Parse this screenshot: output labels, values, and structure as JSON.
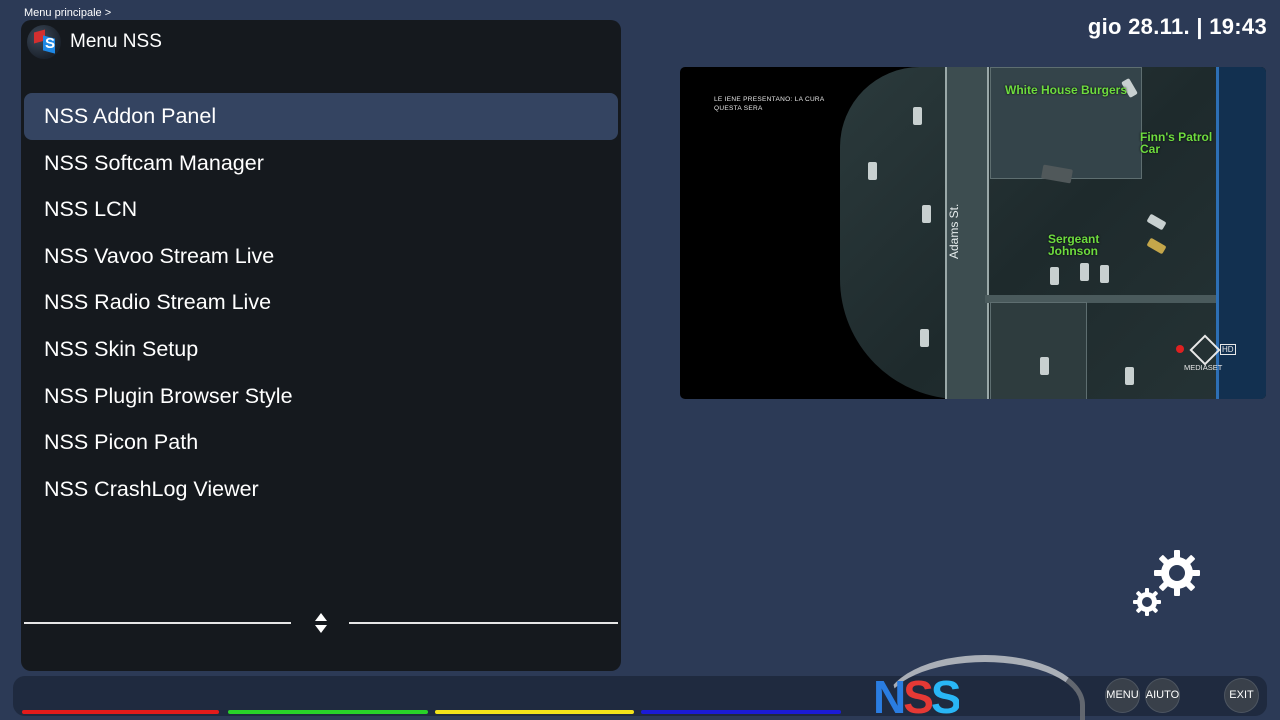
{
  "breadcrumb": "Menu principale >",
  "clock": {
    "date": "gio 28.11.",
    "separator": "|",
    "time": "19:43"
  },
  "menu": {
    "title": "Menu NSS",
    "selected_index": 0,
    "items": [
      "NSS Addon Panel",
      "NSS Softcam Manager",
      "NSS LCN",
      "NSS Vavoo Stream Live",
      "NSS Radio Stream Live",
      "NSS Skin Setup",
      "NSS Plugin Browser Style",
      "NSS Picon Path",
      "NSS CrashLog Viewer"
    ]
  },
  "preview": {
    "overlay_line1": "LE IENE PRESENTANO: LA CURA",
    "overlay_line2": "QUESTA SERA",
    "labels": {
      "white_house": "White House Burgers",
      "finns": "Finn's Patrol Car",
      "sergeant": "Sergeant Johnson",
      "street": "Adams St."
    },
    "channel": "MEDIASET"
  },
  "footer": {
    "logo_text": "NSS",
    "buttons": {
      "menu": "MENU",
      "help": "AIUTO",
      "exit": "EXIT"
    },
    "color_keys": {
      "red": "#e31b1b",
      "green": "#29d129",
      "yellow": "#f2e21b",
      "blue": "#1b1bd6"
    }
  },
  "icons": {
    "header_logo": "nss-cube-icon",
    "settings": "gears-icon",
    "scroll": "up-down-arrows-icon"
  },
  "colors": {
    "background": "#2c3a56",
    "panel": "#15191e",
    "selection": "#344461",
    "accent_green_label": "#6edc3f"
  }
}
